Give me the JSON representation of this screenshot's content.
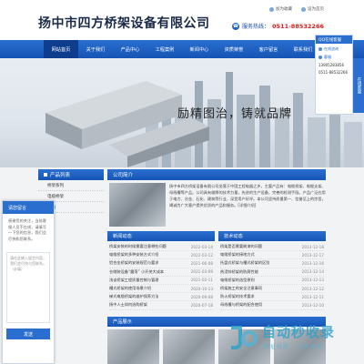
{
  "header": {
    "logo": "扬中市四方桥架设备有限公司",
    "links": [
      "加为收藏",
      "设为首页"
    ],
    "hotline_label": "服务热线：",
    "hotline_number": "0511-88532266"
  },
  "nav": {
    "items": [
      "网站首页",
      "关于我们",
      "产品中心",
      "工程案例",
      "新闻中心",
      "资质荣誉",
      "客户留言",
      "联系我们"
    ]
  },
  "banner": {
    "slogan": "励精图治，铸就品牌"
  },
  "side": {
    "float_label": "在线客服",
    "panel_title": "QQ在线客服",
    "rows": [
      "在线咨询",
      "客服",
      "13905283856",
      "0511-88532266"
    ]
  },
  "left": {
    "title": "产品列表",
    "items": [
      "桥架系列",
      "电缆桥架",
      "线槽"
    ]
  },
  "intro": {
    "title": "公司简介",
    "text": "扬中市四方桥架设备有限公司坐落于中国工程电器之乡，主要产品有：电缆桥架、电缆支架、母线槽等产品。公司具有雄厚的技术力量，先进的生产设备，完善的检测手段。产品广泛应用于电力、冶金、石化、建筑等行业，深受用户好评。本公司坚持质量第一、信誉至上的宗旨，竭诚为广大客户提供优质的产品和服务。[详细介绍]"
  },
  "news": {
    "left_title": "新闻动态",
    "right_title": "技术动态",
    "left_items": [
      {
        "t": "桥架安装的时候需要注意哪些问题",
        "d": "2022-03-14"
      },
      {
        "t": "电缆桥架的多种安装方式介绍",
        "d": "2022-03-12"
      },
      {
        "t": "铝合金桥架的安装规范与要求",
        "d": "2021-06-08"
      },
      {
        "t": "仓储装设备“震荡” 小开关大成本",
        "d": "2021-03-09"
      },
      {
        "t": "浅谈桥架工程质量控制与管理",
        "d": "2021-02-11"
      },
      {
        "t": "槽式桥架的使用场景介绍",
        "d": "2020-10-13"
      },
      {
        "t": "梯式电缆桥架的维护保养方法",
        "d": "2020-09-08"
      },
      {
        "t": "扬中人士如何选购桥架",
        "d": "2020-07-18"
      }
    ],
    "right_items": [
      {
        "t": "桥架是否需要刷漆的问题",
        "d": "2013-12-18"
      },
      {
        "t": "电缆桥架的接地方式",
        "d": "2013-12-17"
      },
      {
        "t": "托盘式桥架与槽式桥架的区别",
        "d": "2013-12-16"
      },
      {
        "t": "热浸锌桥架的防腐性能",
        "d": "2013-12-14"
      },
      {
        "t": "电缆桥架的选型原则",
        "d": "2013-12-13"
      },
      {
        "t": "桥架施工的安全注意事项",
        "d": "2013-12-12"
      },
      {
        "t": "防火桥架的技术要求",
        "d": "2013-12-11"
      },
      {
        "t": "母线槽与桥架的配合使用",
        "d": "2013-12-10"
      }
    ]
  },
  "products": {
    "title": "产品展示"
  },
  "chat": {
    "title": "请您留言",
    "message": "感谢您的关注，当前客服人员不在线，请填写一下您的信息，我们会尽快和您联系。",
    "placeholder": "请在此输入留言内容，我们会尽快与您联系。（必填）",
    "send": "发送"
  },
  "watermark": {
    "title": "自动秒收录",
    "sub": "网址导航 · 分类目录"
  },
  "colors": {
    "primary": "#1654b4",
    "accent": "#2a6fd0",
    "hotline": "#d42020"
  }
}
